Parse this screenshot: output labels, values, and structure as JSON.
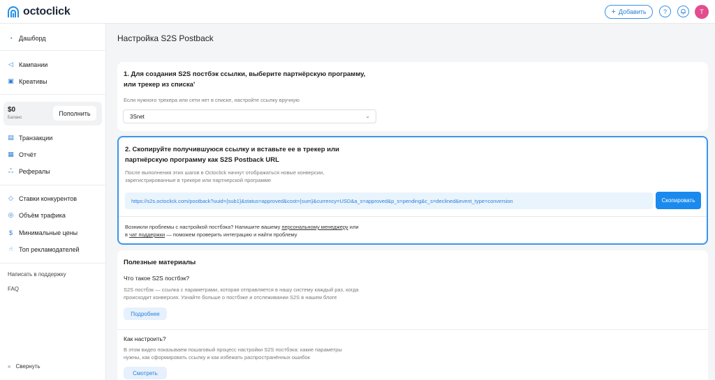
{
  "app": {
    "logo_text": "octoclick"
  },
  "header": {
    "add_label": "Добавить",
    "add_icon": "plus-icon",
    "help_icon": "question-icon",
    "bell_icon": "bell-icon",
    "avatar_letter": "T",
    "avatar_color": "#e34d8f"
  },
  "sidebar": {
    "nav_top": [
      {
        "label": "Дашборд",
        "icon": "dashboard-icon"
      }
    ],
    "nav_campaigns": [
      {
        "label": "Кампании",
        "icon": "megaphone-icon"
      },
      {
        "label": "Креативы",
        "icon": "image-icon"
      }
    ],
    "balance": {
      "amount": "$0",
      "label": "Баланс",
      "topup_label": "Пополнить"
    },
    "nav_finance": [
      {
        "label": "Транзакции",
        "icon": "transactions-icon"
      },
      {
        "label": "Отчёт",
        "icon": "report-icon"
      },
      {
        "label": "Рефералы",
        "icon": "referrals-icon"
      }
    ],
    "nav_tools": [
      {
        "label": "Ставки конкурентов",
        "icon": "layers-icon"
      },
      {
        "label": "Объём трафика",
        "icon": "globe-icon"
      },
      {
        "label": "Минимальные цены",
        "icon": "dollar-icon"
      },
      {
        "label": "Топ рекламодателей",
        "icon": "hand-icon"
      }
    ],
    "support_link": "Написать в поддержку",
    "faq_link": "FAQ",
    "collapse_label": "Свернуть"
  },
  "page": {
    "title": "Настройка S2S Postback"
  },
  "step1": {
    "title_line1": "1. Для создания S2S постбэк ссылки, выберите партнёрскую программу,",
    "title_line2": "или трекер из списка'",
    "hint": "Если нужного трекера или сети нет в списке, настройте ссылку вручную",
    "selected": "3Snet"
  },
  "step2": {
    "title_line1": "2. Скопируйте получившуюся ссылку и вставьте ее в трекер или",
    "title_line2": "партнёрскую программу как S2S Postback URL",
    "desc_line1": "После выполнения этих шагов в Octoclick начнут отображаться новые конверсии,",
    "desc_line2": "зарегистрированные в трекере или партнерской программе",
    "url": "https://s2s.octoclick.com/postback?uuid={sub1}&status=approved&cost={sum}&currency=USD&a_s=approved&p_s=pending&c_s=declined&event_type=conversion",
    "copy_label": "Скопировать",
    "help_part1": "Возникли проблемы с настройкой постбэка? Напишите вашему ",
    "help_link1": "персональному менеджеру",
    "help_part2": " или",
    "help_part3": "в ",
    "help_link2": "чат поддержки",
    "help_part4": " — поможем проверить интеграцию и найти проблему"
  },
  "materials": {
    "title": "Полезные материалы",
    "items": [
      {
        "title": "Что такое S2S постбэк?",
        "line1": "S2S постбэк — ссылка с параметрами, которая отправляется в нашу систему каждый раз, когда",
        "line2": "происходит конверсия. Узнайте больше о постбэке и отслеживании S2S в нашем блоге",
        "button": "Подробнее"
      },
      {
        "title": "Как настроить?",
        "line1": "В этом видео показываем пошаговый процесс настройки S2S постбэка: какие параметры",
        "line2": "нужны, как сформировать ссылку и как избежать распространённых ошибок",
        "button": "Смотреть"
      }
    ]
  }
}
